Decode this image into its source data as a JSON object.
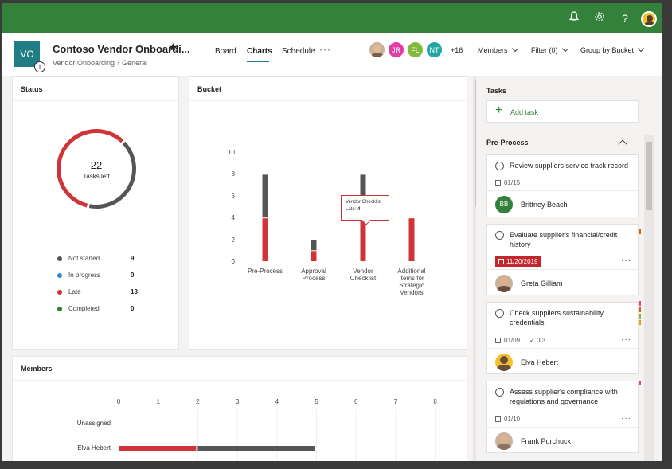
{
  "topbar": {
    "icons": [
      "bell-icon",
      "gear-icon",
      "help-icon"
    ],
    "colors": {
      "bar": "#33813a"
    }
  },
  "plan": {
    "icon_text": "VO",
    "info_icon_text": "i",
    "title": "Contoso Vendor Onboardi...",
    "favorite_icon": "★",
    "breadcrumb": [
      "Vendor Onboarding",
      "General"
    ],
    "colors": {
      "icon": "#217c83"
    }
  },
  "tabs": [
    {
      "label": "Board",
      "active": false
    },
    {
      "label": "Charts",
      "active": true
    },
    {
      "label": "Schedule",
      "active": false
    }
  ],
  "more_label": "···",
  "members_avatars": [
    {
      "initials": "",
      "kind": "photo"
    },
    {
      "initials": "JR",
      "color": "#e43ba6"
    },
    {
      "initials": "FL",
      "color": "#80b93c"
    },
    {
      "initials": "NT",
      "color": "#21a5a6"
    }
  ],
  "extra_members": "+16",
  "header_actions": {
    "members": "Members",
    "filter": "Filter (0)",
    "group_by": "Group by Bucket"
  },
  "status": {
    "title": "Status",
    "tasks_left_count": "22",
    "tasks_left_label": "Tasks left",
    "legend": [
      {
        "label": "Not started",
        "count": "9",
        "color": "#555555"
      },
      {
        "label": "In progress",
        "count": "0",
        "color": "#2b88d8"
      },
      {
        "label": "Late",
        "count": "13",
        "color": "#d13438"
      },
      {
        "label": "Completed",
        "count": "0",
        "color": "#2e7d32"
      }
    ]
  },
  "bucket": {
    "title": "Bucket",
    "tooltip_title": "Vendor Checklist",
    "tooltip_label": "Late:",
    "tooltip_value": "4"
  },
  "members_chart_title": "Members",
  "task_pane": {
    "title": "Tasks",
    "add_task_label": "Add task",
    "section_title": "Pre-Process",
    "tasks": [
      {
        "title": "Review suppliers service track record",
        "date": "01/15",
        "late": false,
        "assignee": "Brittney Beach",
        "assignee_initials": "BB",
        "avatar_color": "#33813a",
        "checklist": ""
      },
      {
        "title": "Evaluate supplier's financial/credit history",
        "date": "11/20/2019",
        "late": true,
        "assignee": "Greta Gilliam",
        "assignee_initials": "",
        "avatar_color": "",
        "checklist": ""
      },
      {
        "title": "Check suppliers sustainability credentials",
        "date": "01/09",
        "late": false,
        "assignee": "Elva Hebert",
        "assignee_initials": "",
        "avatar_color": "",
        "checklist": "0/3"
      },
      {
        "title": "Assess supplier's compliance with regulations and governance",
        "date": "01/10",
        "late": false,
        "assignee": "Frank Purchuck",
        "assignee_initials": "",
        "avatar_color": "",
        "checklist": ""
      }
    ],
    "label_colors": [
      "#e8590c",
      "#e43ba6",
      "#80b93c",
      "#e8a10c"
    ]
  },
  "chart_data": [
    {
      "type": "pie",
      "title": "Status",
      "categories": [
        "Not started",
        "In progress",
        "Late",
        "Completed"
      ],
      "values": [
        9,
        0,
        13,
        0
      ],
      "center_label": "22 Tasks left"
    },
    {
      "type": "bar",
      "title": "Bucket",
      "categories": [
        "Pre-Process",
        "Approval Process",
        "Vendor Checklist",
        "Additional Items for Strategic Vendors"
      ],
      "series": [
        {
          "name": "Late",
          "values": [
            4,
            1,
            4,
            4
          ],
          "color": "#d13438"
        },
        {
          "name": "Not started",
          "values": [
            4,
            1,
            4,
            0
          ],
          "color": "#555555"
        }
      ],
      "stacked": true,
      "ylim": [
        0,
        10
      ],
      "yticks": [
        0,
        2,
        4,
        6,
        8,
        10
      ]
    },
    {
      "type": "bar",
      "orientation": "horizontal",
      "title": "Members",
      "categories": [
        "Unassigned",
        "Elva Hebert"
      ],
      "series": [
        {
          "name": "Late",
          "values": [
            0,
            2
          ],
          "color": "#d13438"
        },
        {
          "name": "Not started",
          "values": [
            0,
            3
          ],
          "color": "#555555"
        }
      ],
      "stacked": true,
      "xlim": [
        0,
        8
      ],
      "xticks": [
        0,
        1,
        2,
        3,
        4,
        5,
        6,
        7,
        8
      ]
    }
  ]
}
